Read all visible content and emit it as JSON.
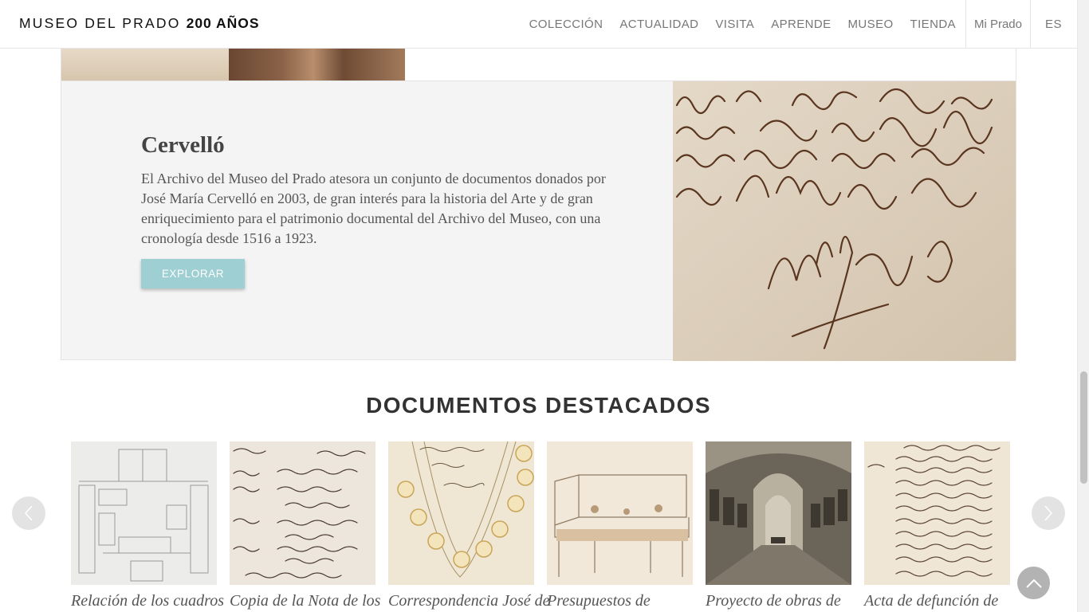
{
  "header": {
    "logo_main": "MUSEO DEL PRADO",
    "logo_bold": "200 AÑOS",
    "nav": [
      "COLECCIÓN",
      "ACTUALIDAD",
      "VISITA",
      "APRENDE",
      "MUSEO",
      "TIENDA"
    ],
    "mi_prado": "Mi Prado",
    "lang": "ES"
  },
  "feature": {
    "title": "Cervelló",
    "text": "El Archivo del Museo del Prado atesora un conjunto de documentos donados por José María Cervelló en 2003, de gran interés para la historia del Arte y de gran enriquecimiento para el patrimonio documental del Archivo del Museo, con una cronología desde 1516 a 1923.",
    "button": "EXPLORAR"
  },
  "documents": {
    "title": "DOCUMENTOS DESTACADOS",
    "cards": [
      {
        "title": "Relación de los cuadros"
      },
      {
        "title": "Copia de la Nota de los"
      },
      {
        "title": "Correspondencia José de"
      },
      {
        "title": "Presupuestos de"
      },
      {
        "title": "Proyecto de obras de"
      },
      {
        "title": "Acta de defunción de"
      }
    ]
  },
  "icons": {
    "prev": "chevron-left-icon",
    "next": "chevron-right-icon",
    "top": "chevron-up-icon"
  },
  "colors": {
    "button_bg": "#9ecfd3",
    "feature_bg": "#f4f4f4"
  }
}
